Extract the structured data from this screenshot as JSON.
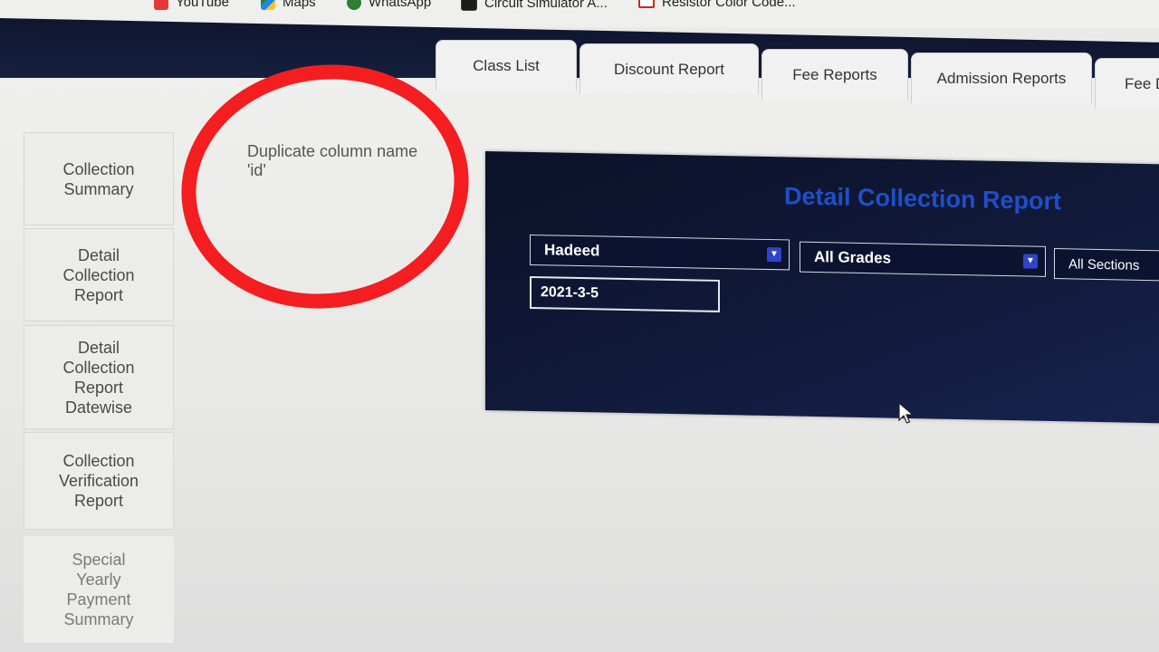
{
  "bookmarks": [
    {
      "label": "YouTube",
      "icon": "youtube-icon"
    },
    {
      "label": "Maps",
      "icon": "maps-icon"
    },
    {
      "label": "WhatsApp",
      "icon": "whatsapp-icon"
    },
    {
      "label": "Circuit Simulator A...",
      "icon": "circuit-simulator-icon"
    },
    {
      "label": "Resistor Color Code...",
      "icon": "resistor-icon"
    }
  ],
  "tabs": [
    {
      "label": "Class List"
    },
    {
      "label": "Discount Report"
    },
    {
      "label": "Fee Reports"
    },
    {
      "label": "Admission Reports"
    },
    {
      "label": "Fee D"
    }
  ],
  "sidebar": {
    "items": [
      {
        "label": "Collection\nSummary"
      },
      {
        "label": "Detail\nCollection\nReport"
      },
      {
        "label": "Detail\nCollection\nReport\nDatewise"
      },
      {
        "label": "Collection\nVerification\nReport"
      },
      {
        "label": "Special\nYearly\nPayment\nSummary"
      }
    ]
  },
  "error": {
    "message": "Duplicate column name 'id'"
  },
  "report": {
    "title": "Detail Collection Report",
    "campus_select": "Hadeed",
    "grade_select": "All Grades",
    "section_select": "All Sections",
    "date_value": "2021-3-5"
  },
  "colors": {
    "header_dark": "#0f1630",
    "panel_bg": "#0b1128",
    "title_blue": "#1f4fc8",
    "caret_blue": "#2e45c9",
    "annotation_red": "#f41d1f"
  }
}
